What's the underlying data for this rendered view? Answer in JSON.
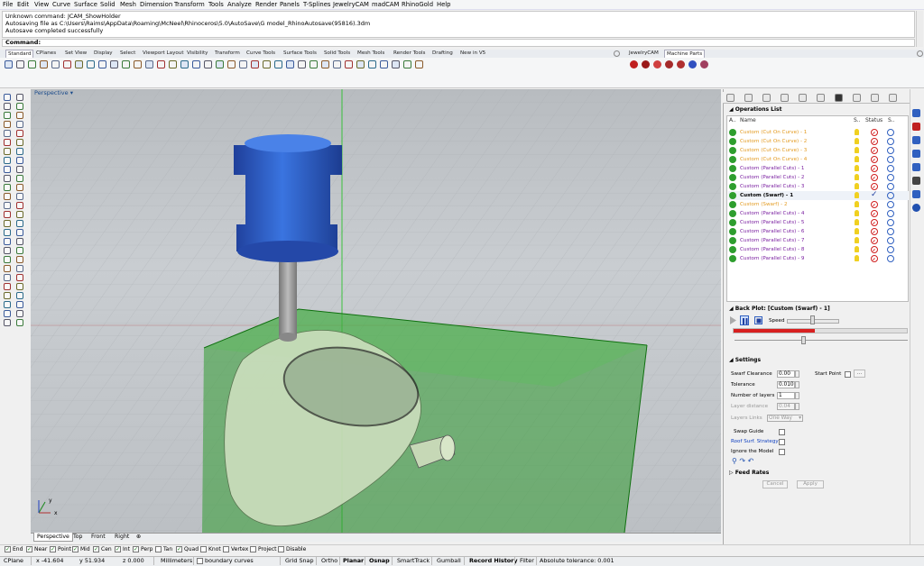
{
  "menu": [
    "File",
    "Edit",
    "View",
    "Curve",
    "Surface",
    "Solid",
    "Mesh",
    "Dimension",
    "Transform",
    "Tools",
    "Analyze",
    "Render",
    "Panels",
    "T-Splines",
    "JewelryCAM",
    "madCAM",
    "RhinoGold",
    "Help"
  ],
  "command_history": [
    "Unknown command: JCAM_ShowHolder",
    "Autosaving file as C:\\Users\\Raims\\AppData\\Roaming\\McNeel\\Rhinoceros\\5.0\\AutoSave\\G model_RhinoAutosave(95816).3dm",
    "Autosave completed successfully"
  ],
  "command_label": "Command:",
  "toolbar_tabs": [
    "Standard",
    "CPlanes",
    "Set View",
    "Display",
    "Select",
    "Viewport Layout",
    "Visibility",
    "Transform",
    "Curve Tools",
    "Surface Tools",
    "Solid Tools",
    "Mesh Tools",
    "Render Tools",
    "Drafting",
    "New in V5"
  ],
  "right_toolbar_tabs": [
    "JewelryCAM",
    "Machine Parts"
  ],
  "viewport": {
    "title": "Perspective",
    "axis_y": "y",
    "axis_x": "x"
  },
  "viewport_tabs": [
    "Perspective",
    "Top",
    "Front",
    "Right"
  ],
  "osnaps": [
    {
      "label": "End",
      "checked": true
    },
    {
      "label": "Near",
      "checked": true
    },
    {
      "label": "Point",
      "checked": true
    },
    {
      "label": "Mid",
      "checked": true
    },
    {
      "label": "Cen",
      "checked": true
    },
    {
      "label": "Int",
      "checked": true
    },
    {
      "label": "Perp",
      "checked": true
    },
    {
      "label": "Tan",
      "checked": false
    },
    {
      "label": "Quad",
      "checked": true
    },
    {
      "label": "Knot",
      "checked": false
    },
    {
      "label": "Vertex",
      "checked": false
    },
    {
      "label": "Project",
      "checked": false
    },
    {
      "label": "Disable",
      "checked": false
    }
  ],
  "status": {
    "cplane": "CPlane",
    "x": "x -41.604",
    "y": "y 51.934",
    "z": "z 0.000",
    "units": "Millimeters",
    "layer": "boundary curves",
    "grid_snap": "Grid Snap",
    "ortho": "Ortho",
    "planar": "Planar",
    "osnap": "Osnap",
    "smarttrack": "SmartTrack",
    "gumball": "Gumball",
    "record_history": "Record History",
    "filter": "Filter",
    "tolerance": "Absolute tolerance: 0.001"
  },
  "operations": {
    "title": "Operations List",
    "headers": {
      "a": "A..",
      "name": "Name",
      "s": "S..",
      "status": "Status",
      "s2": "S.."
    },
    "rows": [
      {
        "name": "Custom (Cut On Curve) - 1",
        "color": "#e39a1f",
        "status": "error"
      },
      {
        "name": "Custom (Cut On Curve) - 2",
        "color": "#e39a1f",
        "status": "error"
      },
      {
        "name": "Custom (Cut On Curve) - 3",
        "color": "#e39a1f",
        "status": "error"
      },
      {
        "name": "Custom (Cut On Curve) - 4",
        "color": "#e39a1f",
        "status": "error"
      },
      {
        "name": "Custom (Parallel Cuts) - 1",
        "color": "#7a1fa0",
        "status": "error"
      },
      {
        "name": "Custom (Parallel Cuts) - 2",
        "color": "#7a1fa0",
        "status": "error"
      },
      {
        "name": "Custom (Parallel Cuts) - 3",
        "color": "#7a1fa0",
        "status": "error"
      },
      {
        "name": "Custom (Swarf) - 1",
        "color": "#000000",
        "status": "ok",
        "bold": true
      },
      {
        "name": "Custom (Swarf) - 2",
        "color": "#e39a1f",
        "status": "error"
      },
      {
        "name": "Custom (Parallel Cuts) - 4",
        "color": "#7a1fa0",
        "status": "error"
      },
      {
        "name": "Custom (Parallel Cuts) - 5",
        "color": "#7a1fa0",
        "status": "error"
      },
      {
        "name": "Custom (Parallel Cuts) - 6",
        "color": "#7a1fa0",
        "status": "error"
      },
      {
        "name": "Custom (Parallel Cuts) - 7",
        "color": "#7a1fa0",
        "status": "error"
      },
      {
        "name": "Custom (Parallel Cuts) - 8",
        "color": "#7a1fa0",
        "status": "error"
      },
      {
        "name": "Custom (Parallel Cuts) - 9",
        "color": "#7a1fa0",
        "status": "error"
      }
    ]
  },
  "backplot": {
    "title": "Back Plot: [Custom (Swarf) - 1]",
    "speed_label": "Speed",
    "progress": 0.47
  },
  "settings": {
    "title": "Settings",
    "swarf_clearance": {
      "label": "Swarf Clearance",
      "value": "0.00"
    },
    "start_point": {
      "label": "Start Point",
      "button": "..."
    },
    "tolerance": {
      "label": "Tolerance",
      "value": "0.010"
    },
    "layers": {
      "label": "Number of layers",
      "value": "1"
    },
    "layer_distance": {
      "label": "Layer distance",
      "value": "0.04"
    },
    "layers_links": {
      "label": "Layers Links",
      "value": "One Way"
    },
    "swap_guide": "Swap Guide",
    "roof_surf": "Roof Surf. Strategy",
    "ignore_model": "Ignore the Model",
    "feed_rates": "Feed Rates",
    "cancel": "Cancel",
    "apply": "Apply"
  },
  "colors": {
    "stock": "#2f9a2f",
    "holder": "#2b5fcf",
    "part": "#cfe0c0"
  }
}
